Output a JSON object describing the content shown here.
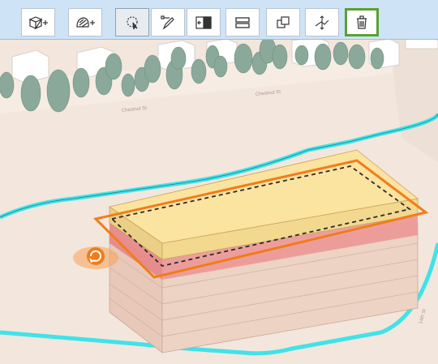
{
  "app": {
    "description_icons": true
  },
  "toolbar": {
    "buttons": [
      {
        "id": "add-building",
        "icon": "cube-plus-icon",
        "active": false
      },
      {
        "id": "add-vegetation",
        "icon": "tree-plus-icon",
        "active": false
      },
      {
        "id": "lasso-select",
        "icon": "lasso-select-icon",
        "active": true
      },
      {
        "id": "draw-shape",
        "icon": "pencil-vertex-icon",
        "active": false
      },
      {
        "id": "split-edit",
        "icon": "split-box-icon",
        "active": false
      },
      {
        "id": "floor-split",
        "icon": "floors-icon",
        "active": false
      },
      {
        "id": "duplicate",
        "icon": "duplicate-icon",
        "active": false
      },
      {
        "id": "elevation",
        "icon": "elevation-icon",
        "active": false
      },
      {
        "id": "delete",
        "icon": "trash-icon",
        "active": false,
        "highlighted": true
      }
    ]
  },
  "map": {
    "street_labels": [
      "Chestnut St",
      "Chestnut St",
      "14th St"
    ],
    "colors": {
      "parcel_outline": "#3fe3e8",
      "selection_outline": "#f07d1a",
      "building_top": "#f8d97e",
      "building_selected_band": "#e77f80",
      "building_body": "#e9c9b9",
      "ground": "#f3e6dc",
      "tree": "#8aa99a",
      "toolbar_bg": "#cfe3f6",
      "delete_highlight": "#5aa032"
    }
  }
}
